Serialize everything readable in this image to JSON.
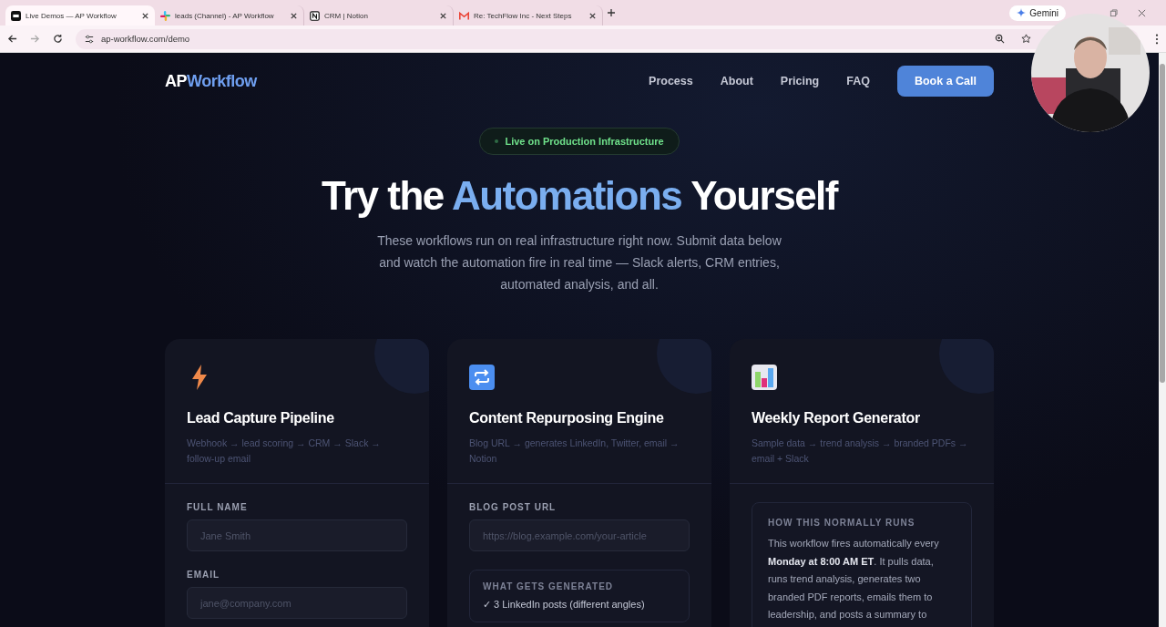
{
  "browser": {
    "tabs": [
      {
        "title": "Live Demos — AP Workflow",
        "selected": true
      },
      {
        "title": "leads (Channel) - AP Workflow",
        "selected": false
      },
      {
        "title": "CRM | Notion",
        "selected": false
      },
      {
        "title": "Re: TechFlow Inc - Next Steps",
        "selected": false
      }
    ],
    "gemini": "Gemini",
    "url": "ap-workflow.com/demo"
  },
  "nav": {
    "logo": [
      "AP",
      "Workflow"
    ],
    "links": [
      "Process",
      "About",
      "Pricing",
      "FAQ"
    ],
    "cta": "Book a Call"
  },
  "hero": {
    "badge": "Live on Production Infrastructure",
    "title": [
      "Try the",
      "Automations",
      "Yourself"
    ],
    "subtitle": "These workflows run on real infrastructure right now. Submit data below and watch the automation fire in real time — Slack alerts, CRM entries, automated analysis, and all."
  },
  "cards": [
    {
      "title": "Lead Capture Pipeline",
      "flow": "Webhook → lead scoring → CRM → Slack → follow-up email",
      "body": [
        {
          "kind": "field",
          "label": "FULL NAME",
          "placeholder": "Jane Smith"
        },
        {
          "kind": "field",
          "label": "EMAIL",
          "placeholder": "jane@company.com"
        }
      ]
    },
    {
      "title": "Content Repurposing Engine",
      "flow": "Blog URL → generates LinkedIn, Twitter, email → Notion",
      "body": [
        {
          "kind": "field",
          "label": "BLOG POST URL",
          "placeholder": "https://blog.example.com/your-article"
        },
        {
          "kind": "list",
          "heading": "WHAT GETS GENERATED",
          "items": [
            "✓ 3 LinkedIn posts (different angles)"
          ]
        }
      ]
    },
    {
      "title": "Weekly Report Generator",
      "flow": "Sample data → trend analysis → branded PDFs → email + Slack",
      "body": [
        {
          "kind": "info",
          "heading": "HOW THIS NORMALLY RUNS",
          "text": "This workflow fires automatically every **Monday at 8:00 AM ET**. It pulls data, runs trend analysis, generates two branded PDF reports, emails them to leadership, and posts a summary to"
        }
      ]
    }
  ]
}
